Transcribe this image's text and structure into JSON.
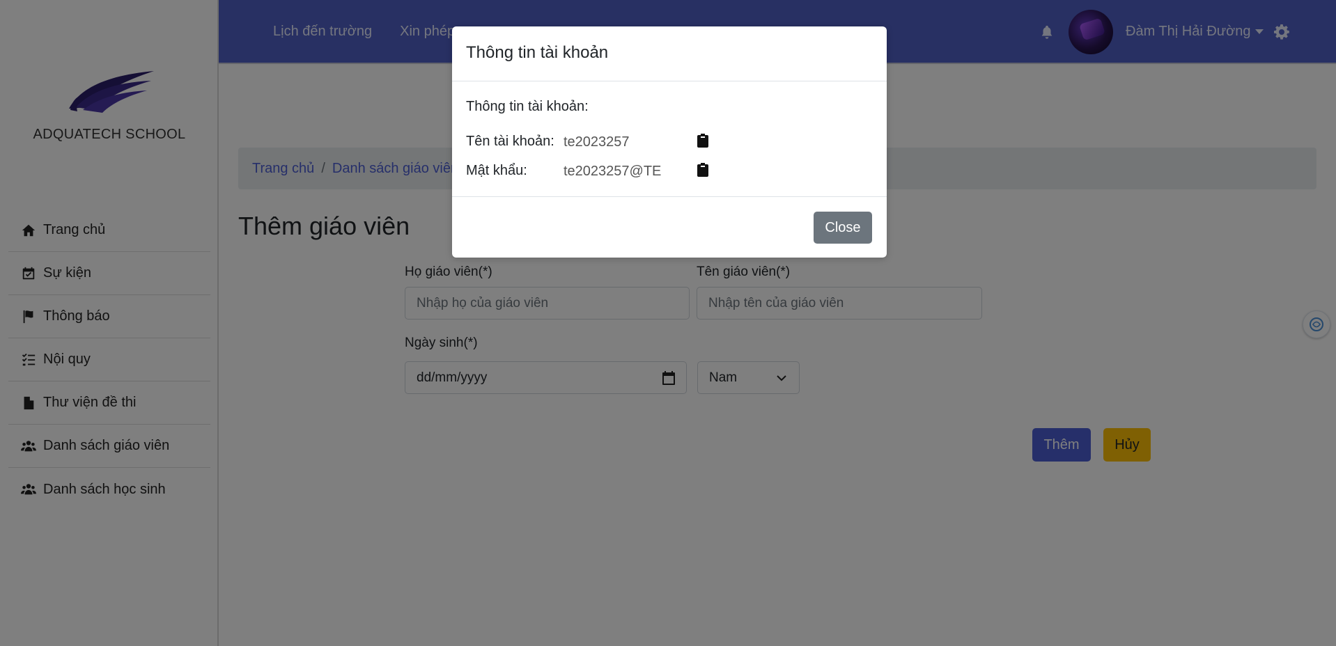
{
  "sidebar": {
    "school_name": "ADQUATECH SCHOOL",
    "items": [
      {
        "label": "Trang chủ",
        "icon": "home-icon"
      },
      {
        "label": "Sự kiện",
        "icon": "calendar-check-icon"
      },
      {
        "label": "Thông báo",
        "icon": "flag-icon"
      },
      {
        "label": "Nội quy",
        "icon": "list-check-icon"
      },
      {
        "label": "Thư viện đề thi",
        "icon": "file-icon"
      },
      {
        "label": "Danh sách giáo viên",
        "icon": "users-icon"
      },
      {
        "label": "Danh sách học sinh",
        "icon": "users-icon"
      }
    ]
  },
  "header": {
    "nav": [
      "Lịch đến trường",
      "Xin phép"
    ],
    "user_name": "Đàm Thị Hải Đường",
    "icons": [
      "bell-icon",
      "avatar",
      "gear-icon"
    ]
  },
  "main": {
    "breadcrumb": [
      "Trang chủ",
      "Danh sách giáo viên"
    ],
    "title": "Thêm giáo viên",
    "form": {
      "last_name_label": "Họ giáo viên(*)",
      "last_name_placeholder": "Nhập họ của giáo viên",
      "first_name_label": "Tên giáo viên(*)",
      "first_name_placeholder": "Nhập tên của giáo viên",
      "dob_label": "Ngày sinh(*)",
      "dob_value": "dd/mm/yyyy",
      "gender_value": "Nam"
    },
    "buttons": {
      "add": "Thêm",
      "cancel": "Hủy"
    }
  },
  "modal": {
    "title": "Thông tin tài khoản",
    "subtitle": "Thông tin tài khoản:",
    "username_label": "Tên tài khoản:",
    "username_value": "te2023257",
    "password_label": "Mật khẩu:",
    "password_value": "te2023257@TE",
    "close_label": "Close"
  },
  "colors": {
    "header_bg": "#5060c6",
    "primary": "#4c5fd5",
    "warning": "#ffc107",
    "secondary": "#6c757d"
  }
}
